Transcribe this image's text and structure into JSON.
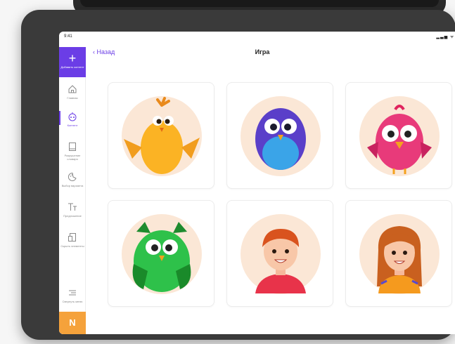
{
  "status": {
    "time": "9:41",
    "indicators": "▂▃▅ ᯤ ▬"
  },
  "sidebar": {
    "add": {
      "icon": "plus-icon",
      "label": "Добавить контент"
    },
    "items": [
      {
        "icon": "home-icon",
        "label": "Главная"
      },
      {
        "icon": "gamepad-icon",
        "label": "Контент"
      },
      {
        "icon": "book-icon",
        "label": "Разрушение словаря"
      },
      {
        "icon": "palette-icon",
        "label": "Выбор варианта"
      },
      {
        "icon": "text-icon",
        "label": "Предложение"
      },
      {
        "icon": "hide-icon",
        "label": "Скрыть элементы"
      },
      {
        "icon": "collapse-menu-icon",
        "label": "Свернуть меню"
      }
    ],
    "active_index": 1,
    "accent": "#6b3de6",
    "n_tile": {
      "letter": "N",
      "color": "#f5a23b"
    }
  },
  "header": {
    "back_label": "‹ Назад",
    "title": "Игра"
  },
  "avatars": [
    {
      "name": "yellow-chicken-avatar"
    },
    {
      "name": "blue-bird-avatar"
    },
    {
      "name": "pink-bird-avatar"
    },
    {
      "name": "green-owl-avatar"
    },
    {
      "name": "boy-avatar"
    },
    {
      "name": "girl-avatar"
    }
  ]
}
